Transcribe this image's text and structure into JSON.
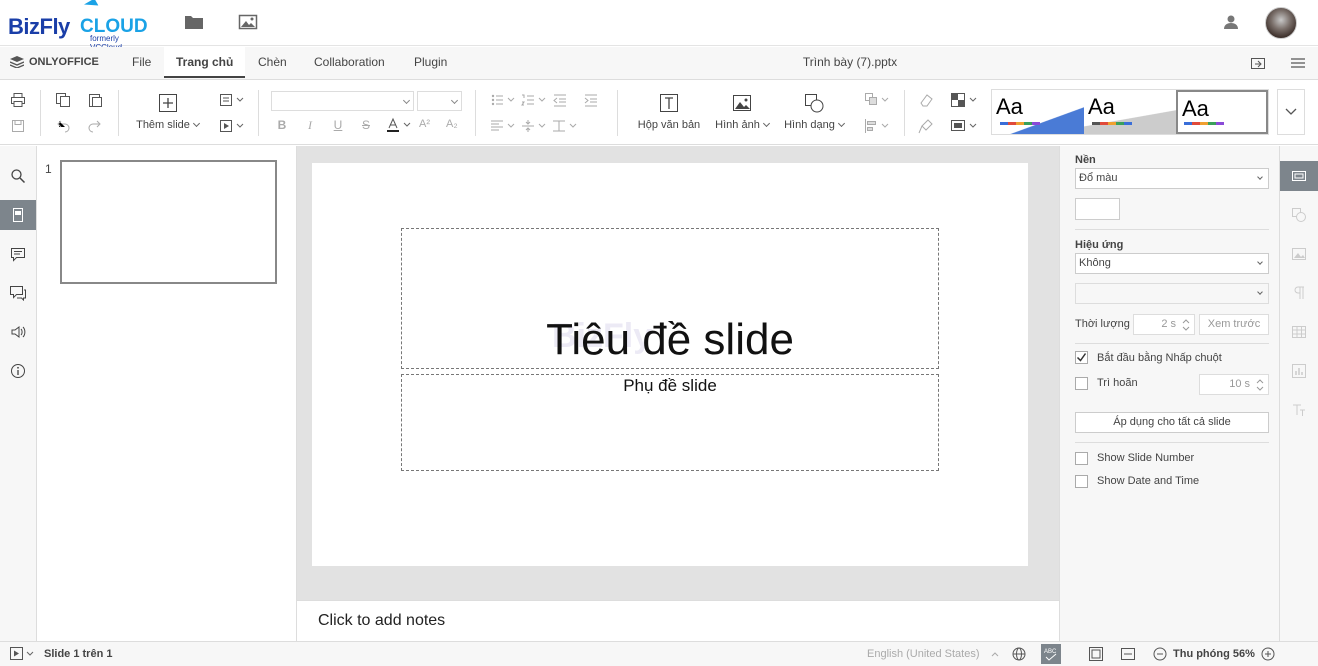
{
  "topbar": {
    "brand_main": "BizFly",
    "brand_sub": "CLOUD",
    "brand_tag": "formerly VCCloud",
    "icons": [
      "folder-icon",
      "image-icon",
      "user-icon"
    ]
  },
  "menubar": {
    "app_name": "ONLYOFFICE",
    "tabs": [
      {
        "label": "File"
      },
      {
        "label": "Trang chủ",
        "active": true
      },
      {
        "label": "Chèn"
      },
      {
        "label": "Collaboration"
      },
      {
        "label": "Plugin"
      }
    ],
    "doc_title": "Trình bày (7).pptx"
  },
  "toolbar": {
    "add_slide_label": "Thêm slide",
    "textbox_label": "Hộp văn bản",
    "image_label": "Hình ảnh",
    "shape_label": "Hình dạng",
    "theme_sample": "Aa",
    "themes": [
      "Aa",
      "Aa",
      "Aa"
    ]
  },
  "thumbnails": {
    "items": [
      {
        "number": "1"
      }
    ]
  },
  "slide": {
    "title": "Tiêu đề slide",
    "subtitle": "Phụ đề slide",
    "watermark": "BizFly"
  },
  "notes": {
    "placeholder": "Click to add notes"
  },
  "right_panel": {
    "background_label": "Nền",
    "background_value": "Đổ màu",
    "effect_label": "Hiệu ứng",
    "effect_value": "Không",
    "duration_label": "Thời lượng",
    "duration_value": "2 s",
    "preview_label": "Xem trước",
    "on_click_label": "Bắt đầu bằng Nhấp chuột",
    "on_click_checked": true,
    "delay_label": "Trì hoãn",
    "delay_value": "10 s",
    "apply_all_label": "Áp dụng cho tất cả slide",
    "slide_number_label": "Show Slide Number",
    "date_time_label": "Show Date and Time"
  },
  "status": {
    "slide_info": "Slide 1 trên 1",
    "language": "English (United States)",
    "zoom_label": "Thu phóng 56%"
  },
  "colors": {
    "accent_blue": "#1a3ea8",
    "cloud_blue": "#1aa2e6",
    "active_rail": "#7d858c"
  }
}
